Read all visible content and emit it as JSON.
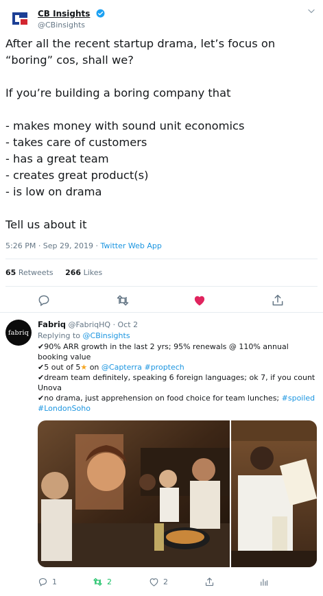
{
  "tweet": {
    "author_name": "CB Insights",
    "author_handle": "@CBinsights",
    "lines": [
      "After all the recent startup drama, let’s focus on",
      "“boring” cos, shall we?",
      "",
      "If you’re building a boring company that",
      "",
      "- makes money with sound unit economics",
      "- takes care of customers",
      "- has a great team",
      "- creates great product(s)",
      "- is low on drama",
      "",
      "Tell us about it"
    ],
    "time": "5:26 PM · Sep 29, 2019 · ",
    "source": "Twitter Web App",
    "retweets_count": "65",
    "retweets_label": "Retweets",
    "likes_count": "266",
    "likes_label": "Likes"
  },
  "reply": {
    "avatar_text": "fabriq",
    "author_name": "Fabriq",
    "author_handle": "@FabriqHQ",
    "date": "· Oct 2",
    "replying_prefix": "Replying to ",
    "replying_to": "@CBinsights",
    "line1": "90% ARR growth in the last 2 yrs; 95% renewals @ 110% annual booking value",
    "line2_a": "5 out of 5",
    "line2_b": " on ",
    "line2_link1": "@Capterra",
    "line2_link2": "#proptech",
    "line3": "dream team definitely, speaking 6 foreign languages; ok 7, if you count Unova",
    "line4": "no drama, just apprehension on food choice for team lunches; ",
    "line4_link1": "#spoiled",
    "line4_link2": "#LondonSoho",
    "replies_count": "1",
    "retweets_count": "2",
    "likes_count": "2"
  },
  "colors": {
    "link": "#1b95e0",
    "like": "#e0245e",
    "retweet": "#17bf63",
    "muted": "#657786"
  },
  "icons": [
    "cb-insights-logo-icon",
    "verified-icon",
    "chevron-down-icon",
    "reply-icon",
    "retweet-icon",
    "heart-icon",
    "share-icon",
    "analytics-icon"
  ]
}
